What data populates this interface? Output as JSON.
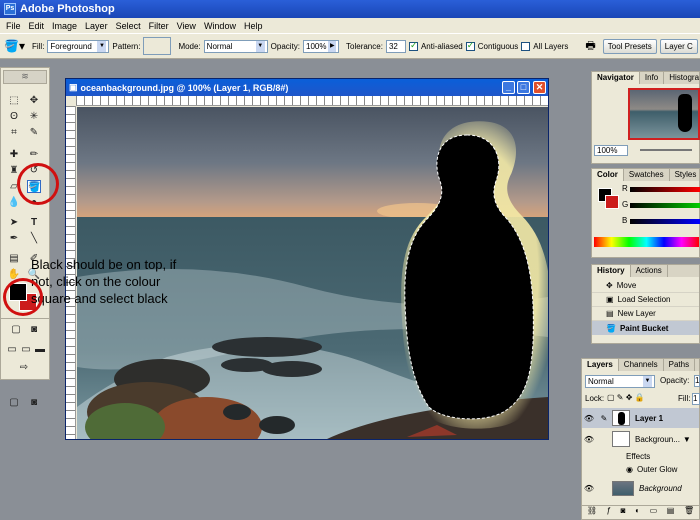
{
  "app": {
    "title": "Adobe Photoshop"
  },
  "menu": [
    "File",
    "Edit",
    "Image",
    "Layer",
    "Select",
    "Filter",
    "View",
    "Window",
    "Help"
  ],
  "options": {
    "fill_label": "Fill:",
    "fill_value": "Foreground",
    "pattern_label": "Pattern:",
    "mode_label": "Mode:",
    "mode_value": "Normal",
    "opacity_label": "Opacity:",
    "opacity_value": "100%",
    "tolerance_label": "Tolerance:",
    "tolerance_value": "32",
    "anti_aliased": "Anti-aliased",
    "contiguous": "Contiguous",
    "all_layers": "All Layers",
    "tool_presets": "Tool Presets",
    "layer_comps": "Layer C"
  },
  "document": {
    "title": "oceanbackground.jpg @ 100% (Layer 1, RGB/8#)"
  },
  "annotation": {
    "text": "Black should be on top, if not, click on the colour square and select black"
  },
  "navigator": {
    "tabs": [
      "Navigator",
      "Info",
      "Histogra"
    ],
    "zoom": "100%"
  },
  "color_panel": {
    "tabs": [
      "Color",
      "Swatches",
      "Styles"
    ],
    "r": "R",
    "g": "G",
    "b": "B"
  },
  "history": {
    "tabs": [
      "History",
      "Actions"
    ],
    "items": [
      "Move",
      "Load Selection",
      "New Layer",
      "Paint Bucket"
    ]
  },
  "layers": {
    "tabs": [
      "Layers",
      "Channels",
      "Paths"
    ],
    "mode": "Normal",
    "opacity_label": "Opacity:",
    "opacity_value": "1",
    "lock_label": "Lock:",
    "fill_label": "Fill:",
    "fill_value": "1",
    "items": [
      "Layer 1",
      "Backgroun...",
      "Effects",
      "Outer Glow",
      "Background"
    ]
  },
  "colors": {
    "fg": "#000000",
    "bg": "#cc1c1c",
    "annotation_circle": "#d01010"
  }
}
